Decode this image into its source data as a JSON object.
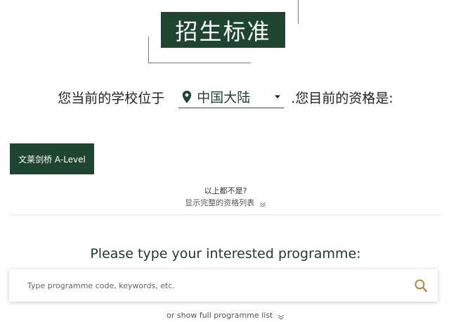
{
  "header": {
    "title": "招生标准"
  },
  "location": {
    "prefix": "您当前的学校位于",
    "selected": "中国大陆",
    "suffix": ".您目前的资格是:",
    "pin_icon": "map-pin-icon",
    "caret_icon": "caret-down-icon"
  },
  "qualifications": {
    "options": [
      "文莱剑桥 A-Level"
    ],
    "none_above": "以上都不是?",
    "show_full": "显示完整的资格列表"
  },
  "programme": {
    "heading": "Please type your interested programme:",
    "placeholder": "Type programme code, keywords, etc.",
    "search_icon": "search-icon",
    "show_full": "or show full programme list"
  },
  "colors": {
    "brand_green": "#1e4530",
    "accent_gold": "#b07a2a"
  }
}
